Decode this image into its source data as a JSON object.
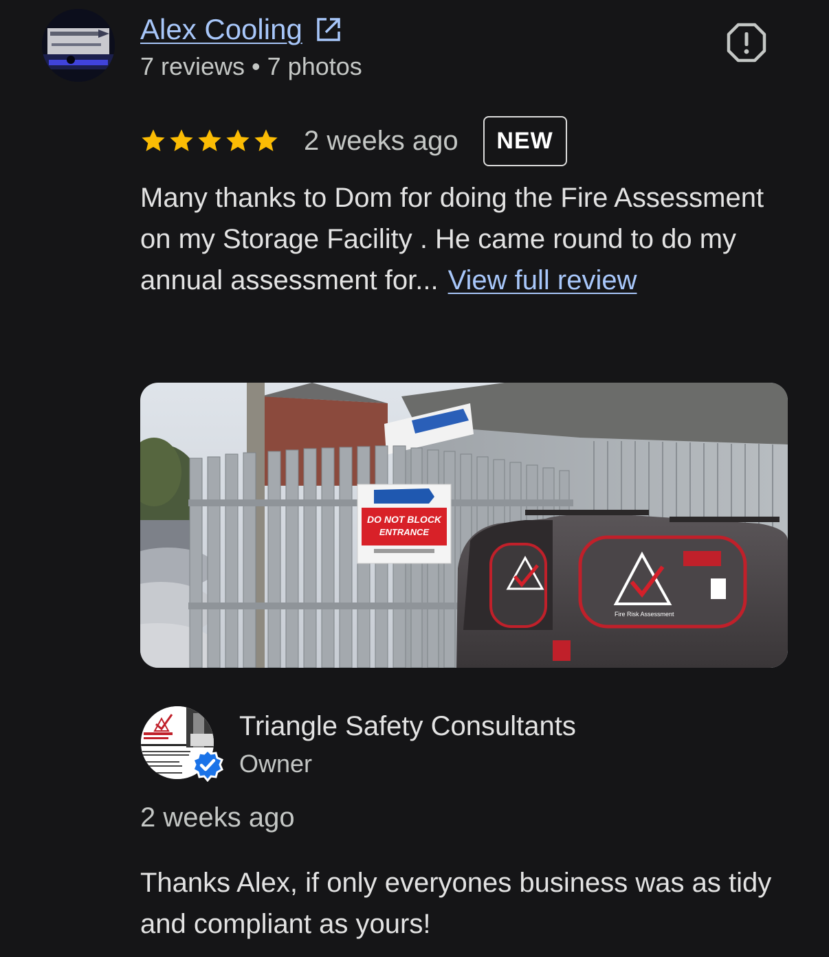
{
  "review": {
    "reviewer_name": "Alex Cooling",
    "reviewer_meta": "7 reviews • 7 photos",
    "rating": 5,
    "max_rating": 5,
    "date": "2 weeks ago",
    "badge": "NEW",
    "text": "Many thanks to Dom for doing the Fire Assessment on my Storage Facility . He came round to do my annual assessment for...",
    "view_full_label": "View full review",
    "photo_icons": {
      "star_color": "#fbbc04",
      "link_color": "#a8c7fa"
    }
  },
  "icons": {
    "external_link": "open-in-new-icon",
    "report": "report-icon",
    "star": "star-icon",
    "verified": "verified-badge-icon"
  },
  "owner_reply": {
    "name": "Triangle Safety Consultants",
    "role": "Owner",
    "date": "2 weeks ago",
    "text": "Thanks Alex, if only everyones business was as tidy and compliant as yours!",
    "verified_color": "#1a73e8"
  },
  "photo_text": {
    "sign_do_not_block": "DO NOT BLOCK",
    "sign_entrance": "ENTRANCE",
    "van_text": "Fire Risk Assessment"
  }
}
